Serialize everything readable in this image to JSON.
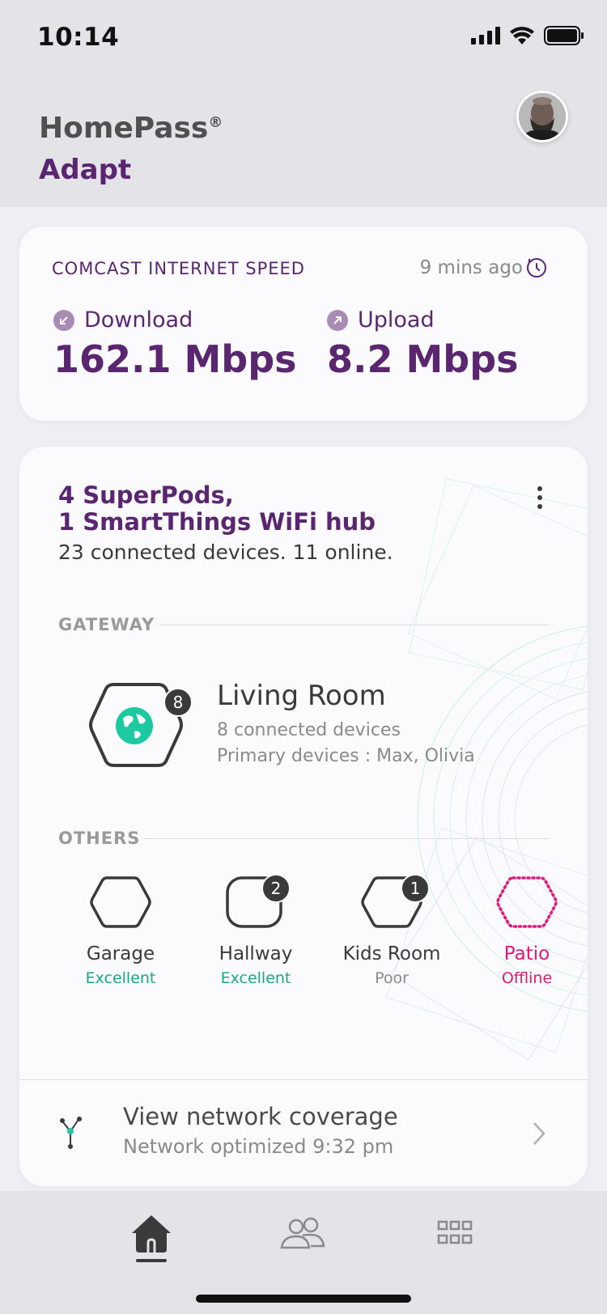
{
  "status_bar": {
    "time": "10:14"
  },
  "header": {
    "title": "HomePass",
    "registered_mark": "®",
    "subtitle": "Adapt"
  },
  "speed": {
    "title": "COMCAST INTERNET SPEED",
    "updated": "9 mins ago",
    "download_label": "Download",
    "download_value": "162.1 Mbps",
    "upload_label": "Upload",
    "upload_value": "8.2 Mbps"
  },
  "network": {
    "title_line1": "4 SuperPods,",
    "title_line2": "1 SmartThings WiFi hub",
    "summary": "23 connected devices. 11 online.",
    "gateway_label": "GATEWAY",
    "gateway": {
      "name": "Living Room",
      "badge": "8",
      "devices": "8 connected devices",
      "primary": "Primary devices : Max, Olivia"
    },
    "others_label": "OTHERS",
    "pods": [
      {
        "name": "Garage",
        "status": "Excellent",
        "badge": ""
      },
      {
        "name": "Hallway",
        "status": "Excellent",
        "badge": "2"
      },
      {
        "name": "Kids Room",
        "status": "Poor",
        "badge": "1"
      },
      {
        "name": "Patio",
        "status": "Offline",
        "badge": ""
      }
    ],
    "coverage_title": "View network coverage",
    "coverage_sub": "Network optimized 9:32 pm"
  },
  "colors": {
    "brand_purple": "#5a2670",
    "good_green": "#19a88a",
    "offline_pink": "#e0197d"
  },
  "tabs": [
    "home-icon",
    "people-icon",
    "apps-grid-icon"
  ]
}
